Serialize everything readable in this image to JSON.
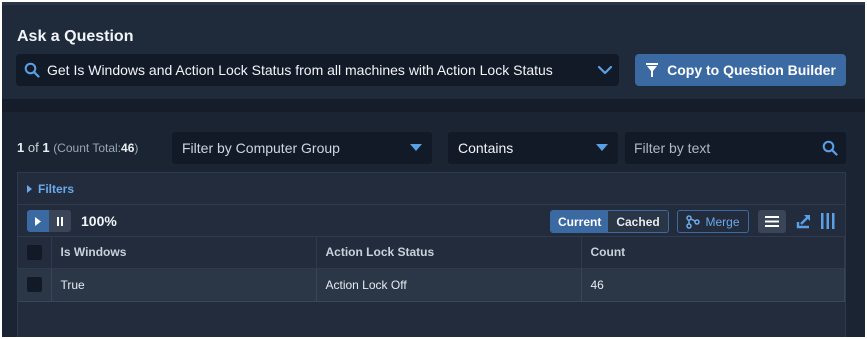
{
  "ask": {
    "title": "Ask a Question",
    "question": "Get Is Windows and Action Lock Status from all machines with Action Lock Status",
    "copy_button": "Copy to Question Builder"
  },
  "results": {
    "page_current": "1",
    "page_of": "of",
    "page_total": "1",
    "count_label": "(Count Total:",
    "count_value": "46",
    "count_close": ")",
    "group_filter": "Filter by Computer Group",
    "match_mode": "Contains",
    "text_filter_placeholder": "Filter by text"
  },
  "grid": {
    "filters_label": "Filters",
    "progress": "100%",
    "view_current": "Current",
    "view_cached": "Cached",
    "merge_label": "Merge",
    "columns": [
      "Is Windows",
      "Action Lock Status",
      "Count"
    ],
    "rows": [
      {
        "is_windows": "True",
        "action_lock_status": "Action Lock Off",
        "count": "46"
      }
    ]
  },
  "colors": {
    "accent": "#3b6aa3",
    "link": "#6aa9ea",
    "background": "#1b2433"
  },
  "icons": {
    "question_search": "search-icon",
    "question_dropdown": "chevron-down-icon",
    "copy": "funnel-icon",
    "text_search": "search-icon",
    "play": "play-icon",
    "pause": "pause-icon",
    "merge": "merge-icon",
    "menu": "hamburger-icon",
    "export": "export-icon",
    "columns": "columns-icon"
  }
}
